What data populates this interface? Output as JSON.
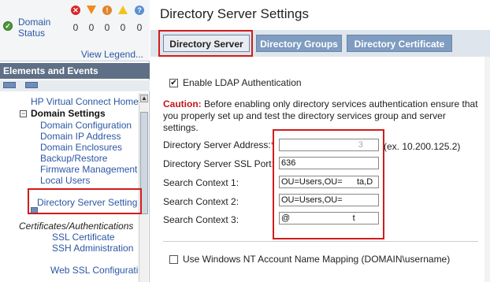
{
  "status_panel": {
    "label": "Domain Status",
    "icons": [
      "critical-icon",
      "major-icon",
      "minor-icon",
      "warning-icon",
      "info-icon"
    ],
    "counts": [
      "0",
      "0",
      "0",
      "0",
      "0"
    ],
    "view_legend": "View Legend..."
  },
  "elements_panel": {
    "title": "Elements and Events",
    "tree": {
      "hp_home": "HP Virtual Connect Home",
      "domain_settings": "Domain Settings",
      "items": [
        "Domain Configuration",
        "Domain IP Address",
        "Domain Enclosures",
        "Backup/Restore",
        "Firmware Management",
        "Local Users"
      ],
      "directory_server_settings": "Directory Server Setting",
      "certificates_heading": "Certificates/Authentications",
      "cert_items": [
        "SSL Certificate",
        "SSH Administration"
      ],
      "web_ssl": "Web SSL Configurati"
    }
  },
  "main": {
    "title": "Directory Server Settings",
    "tabs": [
      "Directory Server",
      "Directory Groups",
      "Directory Certificate"
    ],
    "active_tab": "Directory Server",
    "enable_ldap": {
      "label": "Enable LDAP Authentication",
      "checked": true
    },
    "caution": {
      "label": "Caution:",
      "text": " Before enabling only directory services authentication ensure that you properly set up and test the directory services group and server settings."
    },
    "form": {
      "address": {
        "label": "Directory Server Address:",
        "required": "*",
        "value": "                                3",
        "hint": "(ex. 10.200.125.2)"
      },
      "ssl_port": {
        "label": "Directory Server SSL Port:",
        "value": "636"
      },
      "context1": {
        "label": "Search Context 1:",
        "value": "OU=Users,OU=      ta,D"
      },
      "context2": {
        "label": "Search Context 2:",
        "value": "OU=Users,OU=              "
      },
      "context3": {
        "label": "Search Context 3:",
        "value": "@                          t"
      }
    },
    "nt_mapping": {
      "label": "Use Windows NT Account Name Mapping (DOMAIN\\username)",
      "checked": false
    }
  },
  "colors": {
    "accent_red": "#d11b1b",
    "link_blue": "#2c57a5",
    "header_slate": "#5e6f86",
    "tab_inactive": "#7f9cc1"
  }
}
